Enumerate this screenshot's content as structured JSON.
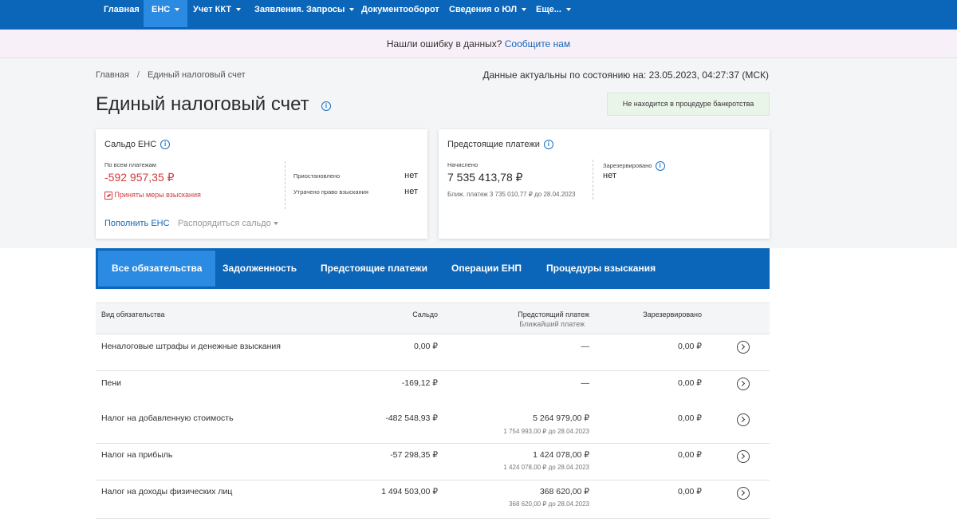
{
  "nav": {
    "items": [
      {
        "label": "Главная",
        "caret": false
      },
      {
        "label": "ЕНС",
        "caret": true,
        "active": true
      },
      {
        "label": "Учет ККТ",
        "caret": true
      },
      {
        "label": "Заявления. Запросы",
        "caret": true
      },
      {
        "label": "Документооборот",
        "caret": false
      },
      {
        "label": "Сведения о ЮЛ",
        "caret": true
      },
      {
        "label": "Еще...",
        "caret": true
      }
    ]
  },
  "notice": {
    "text": "Нашли ошибку в данных? ",
    "link": "Сообщите нам"
  },
  "breadcrumb": {
    "home": "Главная",
    "separator": "/",
    "current": "Единый налоговый счет"
  },
  "actual_text": "Данные актуальны по состоянию на: 23.05.2023, 04:27:37 (МСК)",
  "page_title": "Единый налоговый счет",
  "bankrupt_badge": "Не находится в процедуре банкротства",
  "saldo_card": {
    "title": "Сальдо ЕНС",
    "all_payments_label": "По всем платежам",
    "amount": "-592 957,35 ₽",
    "measures": "Приняты меры взыскания",
    "suspended_label": "Приостановлено",
    "suspended_value": "нет",
    "lost_label": "Утрачено право взыскания",
    "lost_value": "нет",
    "replenish": "Пополнить ЕНС",
    "dispose": "Распорядиться сальдо"
  },
  "upcoming_card": {
    "title": "Предстоящие платежи",
    "accrued_label": "Начислено",
    "accrued_amount": "7 535 413,78 ₽",
    "nearest": "Ближ. платеж 3 735 010,77 ₽ до 28.04.2023",
    "reserved_label": "Зарезервировано",
    "reserved_value": "нет"
  },
  "tabs": [
    {
      "label": "Все обязательства",
      "active": true
    },
    {
      "label": "Задолженность"
    },
    {
      "label": "Предстоящие платежи"
    },
    {
      "label": "Операции ЕНП"
    },
    {
      "label": "Процедуры взыскания"
    }
  ],
  "table": {
    "headers": {
      "type": "Вид обязательства",
      "saldo": "Сальдо",
      "upcoming": "Предстоящий платеж",
      "upcoming_sub": "Ближайший платеж",
      "reserved": "Зарезервировано"
    },
    "rows": [
      {
        "name": "Неналоговые штрафы и денежные взыскания",
        "saldo": "0,00 ₽",
        "saldo_negative": false,
        "upcoming": "—",
        "upcoming_sub": "",
        "reserved": "0,00 ₽"
      },
      {
        "name": "Пени",
        "saldo": "-169,12 ₽",
        "saldo_negative": true,
        "upcoming": "—",
        "upcoming_sub": "",
        "reserved": "0,00 ₽"
      },
      {
        "name": "Налог на добавленную стоимость",
        "saldo": "-482 548,93 ₽",
        "saldo_negative": true,
        "upcoming": "5 264 979,00 ₽",
        "upcoming_sub": "1 754 993,00 ₽ до 28.04.2023",
        "reserved": "0,00 ₽"
      },
      {
        "name": "Налог на прибыль",
        "saldo": "-57 298,35 ₽",
        "saldo_negative": true,
        "upcoming": "1 424 078,00 ₽",
        "upcoming_sub": "1 424 078,00 ₽ до 28.04.2023",
        "reserved": "0,00 ₽"
      },
      {
        "name": "Налог на доходы физических лиц",
        "saldo": "1 494 503,00 ₽",
        "saldo_negative": false,
        "upcoming": "368 620,00 ₽",
        "upcoming_sub": "368 620,00 ₽ до 28.04.2023",
        "reserved": "0,00 ₽"
      }
    ]
  },
  "colors": {
    "nav": "#0b65b8",
    "nav_active": "#2b8ae2",
    "negative": "#d33a3a",
    "link": "#1566b8"
  }
}
